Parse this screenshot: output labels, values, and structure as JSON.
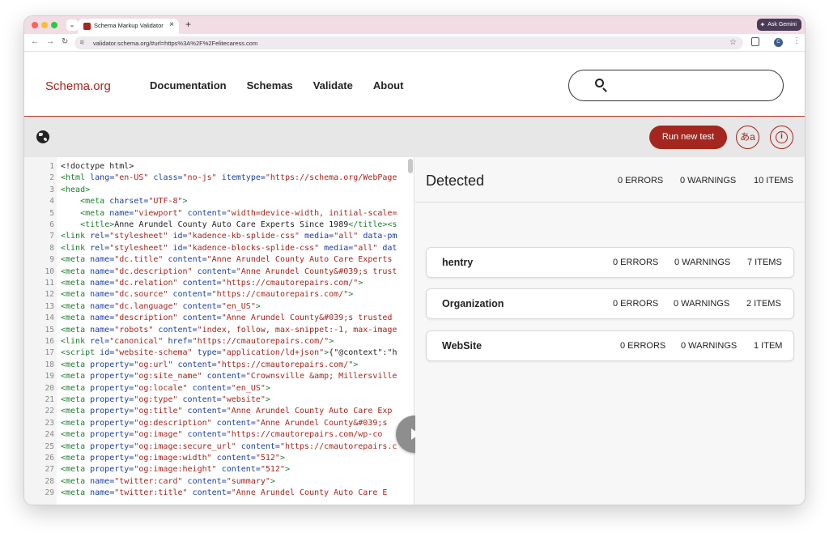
{
  "browser": {
    "tab_title": "Schema Markup Validator",
    "tab_menu_icon": "chevron-down-icon",
    "new_tab_label": "+",
    "gemini_label": "Ask Gemini",
    "url": "validator.schema.org/#url=https%3A%2F%2Felitecaress.com",
    "profile_initial": "C"
  },
  "site": {
    "logo": "Schema.org",
    "nav": [
      "Documentation",
      "Schemas",
      "Validate",
      "About"
    ],
    "search_placeholder": ""
  },
  "toolbar": {
    "run_label": "Run new test",
    "lang_label": "あa",
    "info_label": "i"
  },
  "code_lines": [
    [
      {
        "c": "",
        "t": "<!doctype html>"
      }
    ],
    [
      {
        "c": "t",
        "t": "<html "
      },
      {
        "c": "a",
        "t": "lang="
      },
      {
        "c": "v",
        "t": "\"en-US\" "
      },
      {
        "c": "a",
        "t": "class="
      },
      {
        "c": "v",
        "t": "\"no-js\" "
      },
      {
        "c": "a",
        "t": "itemtype="
      },
      {
        "c": "v",
        "t": "\"https://schema.org/WebPage"
      }
    ],
    [
      {
        "c": "t",
        "t": "<head>"
      }
    ],
    [
      {
        "c": "",
        "t": "    "
      },
      {
        "c": "t",
        "t": "<meta "
      },
      {
        "c": "a",
        "t": "charset="
      },
      {
        "c": "v",
        "t": "\"UTF-8\""
      },
      {
        "c": "t",
        "t": ">"
      }
    ],
    [
      {
        "c": "",
        "t": "    "
      },
      {
        "c": "t",
        "t": "<meta "
      },
      {
        "c": "a",
        "t": "name="
      },
      {
        "c": "v",
        "t": "\"viewport\" "
      },
      {
        "c": "a",
        "t": "content="
      },
      {
        "c": "v",
        "t": "\"width=device-width, initial-scale="
      }
    ],
    [
      {
        "c": "",
        "t": "    "
      },
      {
        "c": "t",
        "t": "<title>"
      },
      {
        "c": "",
        "t": "Anne Arundel County Auto Care Experts Since 1989"
      },
      {
        "c": "t",
        "t": "</title><s"
      }
    ],
    [
      {
        "c": "t",
        "t": "<link "
      },
      {
        "c": "a",
        "t": "rel="
      },
      {
        "c": "v",
        "t": "\"stylesheet\" "
      },
      {
        "c": "a",
        "t": "id="
      },
      {
        "c": "v",
        "t": "\"kadence-kb-splide-css\" "
      },
      {
        "c": "a",
        "t": "media="
      },
      {
        "c": "v",
        "t": "\"all\" "
      },
      {
        "c": "a",
        "t": "data-pm"
      }
    ],
    [
      {
        "c": "t",
        "t": "<link "
      },
      {
        "c": "a",
        "t": "rel="
      },
      {
        "c": "v",
        "t": "\"stylesheet\" "
      },
      {
        "c": "a",
        "t": "id="
      },
      {
        "c": "v",
        "t": "\"kadence-blocks-splide-css\" "
      },
      {
        "c": "a",
        "t": "media="
      },
      {
        "c": "v",
        "t": "\"all\" "
      },
      {
        "c": "a",
        "t": "dat"
      }
    ],
    [
      {
        "c": "t",
        "t": "<meta "
      },
      {
        "c": "a",
        "t": "name="
      },
      {
        "c": "v",
        "t": "\"dc.title\" "
      },
      {
        "c": "a",
        "t": "content="
      },
      {
        "c": "v",
        "t": "\"Anne Arundel County Auto Care Experts "
      }
    ],
    [
      {
        "c": "t",
        "t": "<meta "
      },
      {
        "c": "a",
        "t": "name="
      },
      {
        "c": "v",
        "t": "\"dc.description\" "
      },
      {
        "c": "a",
        "t": "content="
      },
      {
        "c": "v",
        "t": "\"Anne Arundel County&#039;s trust"
      }
    ],
    [
      {
        "c": "t",
        "t": "<meta "
      },
      {
        "c": "a",
        "t": "name="
      },
      {
        "c": "v",
        "t": "\"dc.relation\" "
      },
      {
        "c": "a",
        "t": "content="
      },
      {
        "c": "v",
        "t": "\"https://cmautorepairs.com/\""
      },
      {
        "c": "t",
        "t": ">"
      }
    ],
    [
      {
        "c": "t",
        "t": "<meta "
      },
      {
        "c": "a",
        "t": "name="
      },
      {
        "c": "v",
        "t": "\"dc.source\" "
      },
      {
        "c": "a",
        "t": "content="
      },
      {
        "c": "v",
        "t": "\"https://cmautorepairs.com/\""
      },
      {
        "c": "t",
        "t": ">"
      }
    ],
    [
      {
        "c": "t",
        "t": "<meta "
      },
      {
        "c": "a",
        "t": "name="
      },
      {
        "c": "v",
        "t": "\"dc.language\" "
      },
      {
        "c": "a",
        "t": "content="
      },
      {
        "c": "v",
        "t": "\"en_US\""
      },
      {
        "c": "t",
        "t": ">"
      }
    ],
    [
      {
        "c": "t",
        "t": "<meta "
      },
      {
        "c": "a",
        "t": "name="
      },
      {
        "c": "v",
        "t": "\"description\" "
      },
      {
        "c": "a",
        "t": "content="
      },
      {
        "c": "v",
        "t": "\"Anne Arundel County&#039;s trusted "
      }
    ],
    [
      {
        "c": "t",
        "t": "<meta "
      },
      {
        "c": "a",
        "t": "name="
      },
      {
        "c": "v",
        "t": "\"robots\" "
      },
      {
        "c": "a",
        "t": "content="
      },
      {
        "c": "v",
        "t": "\"index, follow, max-snippet:-1, max-image"
      }
    ],
    [
      {
        "c": "t",
        "t": "<link "
      },
      {
        "c": "a",
        "t": "rel="
      },
      {
        "c": "v",
        "t": "\"canonical\" "
      },
      {
        "c": "a",
        "t": "href="
      },
      {
        "c": "v",
        "t": "\"https://cmautorepairs.com/\""
      },
      {
        "c": "t",
        "t": ">"
      }
    ],
    [
      {
        "c": "t",
        "t": "<script "
      },
      {
        "c": "a",
        "t": "id="
      },
      {
        "c": "v",
        "t": "\"website-schema\" "
      },
      {
        "c": "a",
        "t": "type="
      },
      {
        "c": "v",
        "t": "\"application/ld+json\""
      },
      {
        "c": "t",
        "t": ">"
      },
      {
        "c": "",
        "t": "{\"@context\":\"h"
      }
    ],
    [
      {
        "c": "t",
        "t": "<meta "
      },
      {
        "c": "a",
        "t": "property="
      },
      {
        "c": "v",
        "t": "\"og:url\" "
      },
      {
        "c": "a",
        "t": "content="
      },
      {
        "c": "v",
        "t": "\"https://cmautorepairs.com/\""
      },
      {
        "c": "t",
        "t": ">"
      }
    ],
    [
      {
        "c": "t",
        "t": "<meta "
      },
      {
        "c": "a",
        "t": "property="
      },
      {
        "c": "v",
        "t": "\"og:site_name\" "
      },
      {
        "c": "a",
        "t": "content="
      },
      {
        "c": "v",
        "t": "\"Crownsville &amp; Millersville"
      }
    ],
    [
      {
        "c": "t",
        "t": "<meta "
      },
      {
        "c": "a",
        "t": "property="
      },
      {
        "c": "v",
        "t": "\"og:locale\" "
      },
      {
        "c": "a",
        "t": "content="
      },
      {
        "c": "v",
        "t": "\"en_US\""
      },
      {
        "c": "t",
        "t": ">"
      }
    ],
    [
      {
        "c": "t",
        "t": "<meta "
      },
      {
        "c": "a",
        "t": "property="
      },
      {
        "c": "v",
        "t": "\"og:type\" "
      },
      {
        "c": "a",
        "t": "content="
      },
      {
        "c": "v",
        "t": "\"website\""
      },
      {
        "c": "t",
        "t": ">"
      }
    ],
    [
      {
        "c": "t",
        "t": "<meta "
      },
      {
        "c": "a",
        "t": "property="
      },
      {
        "c": "v",
        "t": "\"og:title\" "
      },
      {
        "c": "a",
        "t": "content="
      },
      {
        "c": "v",
        "t": "\"Anne Arundel County Auto Care Exp"
      }
    ],
    [
      {
        "c": "t",
        "t": "<meta "
      },
      {
        "c": "a",
        "t": "property="
      },
      {
        "c": "v",
        "t": "\"og:description\" "
      },
      {
        "c": "a",
        "t": "content="
      },
      {
        "c": "v",
        "t": "\"Anne Arundel County&#039;s"
      }
    ],
    [
      {
        "c": "t",
        "t": "<meta "
      },
      {
        "c": "a",
        "t": "property="
      },
      {
        "c": "v",
        "t": "\"og:image\" "
      },
      {
        "c": "a",
        "t": "content="
      },
      {
        "c": "v",
        "t": "\"https://cmautorepairs.com/wp-co"
      }
    ],
    [
      {
        "c": "t",
        "t": "<meta "
      },
      {
        "c": "a",
        "t": "property="
      },
      {
        "c": "v",
        "t": "\"og:image:secure_url\" "
      },
      {
        "c": "a",
        "t": "content="
      },
      {
        "c": "v",
        "t": "\"https://cmautorepairs.c"
      }
    ],
    [
      {
        "c": "t",
        "t": "<meta "
      },
      {
        "c": "a",
        "t": "property="
      },
      {
        "c": "v",
        "t": "\"og:image:width\" "
      },
      {
        "c": "a",
        "t": "content="
      },
      {
        "c": "v",
        "t": "\"512\""
      },
      {
        "c": "t",
        "t": ">"
      }
    ],
    [
      {
        "c": "t",
        "t": "<meta "
      },
      {
        "c": "a",
        "t": "property="
      },
      {
        "c": "v",
        "t": "\"og:image:height\" "
      },
      {
        "c": "a",
        "t": "content="
      },
      {
        "c": "v",
        "t": "\"512\""
      },
      {
        "c": "t",
        "t": ">"
      }
    ],
    [
      {
        "c": "t",
        "t": "<meta "
      },
      {
        "c": "a",
        "t": "name="
      },
      {
        "c": "v",
        "t": "\"twitter:card\" "
      },
      {
        "c": "a",
        "t": "content="
      },
      {
        "c": "v",
        "t": "\"summary\""
      },
      {
        "c": "t",
        "t": ">"
      }
    ],
    [
      {
        "c": "t",
        "t": "<meta "
      },
      {
        "c": "a",
        "t": "name="
      },
      {
        "c": "v",
        "t": "\"twitter:title\" "
      },
      {
        "c": "a",
        "t": "content="
      },
      {
        "c": "v",
        "t": "\"Anne Arundel County Auto Care E"
      }
    ]
  ],
  "results": {
    "title": "Detected",
    "errors": "0 ERRORS",
    "warnings": "0 WARNINGS",
    "items": "10 ITEMS",
    "cards": [
      {
        "name": "hentry",
        "errors": "0 ERRORS",
        "warnings": "0 WARNINGS",
        "items": "7 ITEMS"
      },
      {
        "name": "Organization",
        "errors": "0 ERRORS",
        "warnings": "0 WARNINGS",
        "items": "2 ITEMS"
      },
      {
        "name": "WebSite",
        "errors": "0 ERRORS",
        "warnings": "0 WARNINGS",
        "items": "1 ITEM"
      }
    ]
  },
  "colors": {
    "brand": "#a3271f",
    "tag": "#1d7f2f",
    "attr": "#1b3fa1",
    "value": "#a3271f"
  }
}
